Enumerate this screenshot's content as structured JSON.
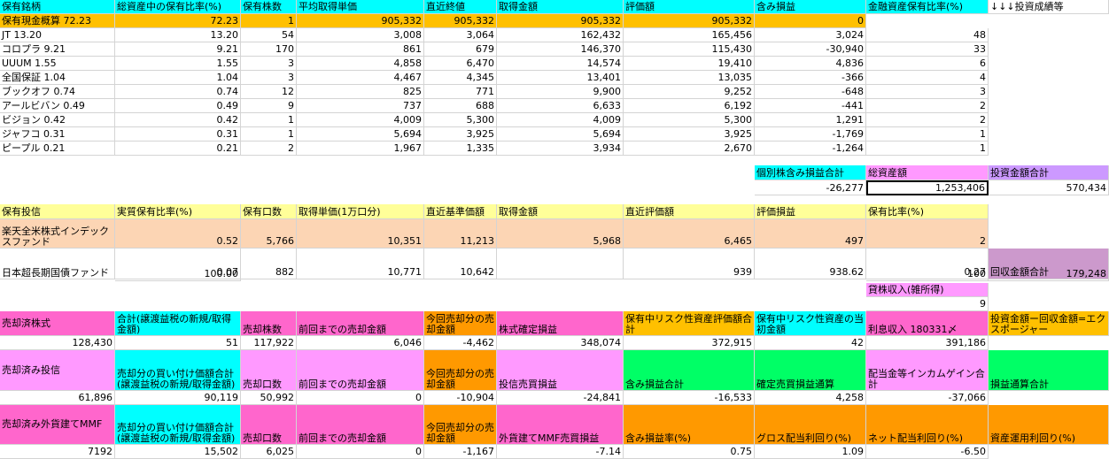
{
  "colors": {
    "cyan": "#00ffff",
    "yellow": "#ffff99",
    "gold": "#ffc000",
    "peach": "#fcd5b4",
    "pink": "#ff66cc",
    "magenta": "#ff99ff",
    "orange": "#ff9900",
    "green": "#00ff66",
    "purple": "#cc99ff",
    "mauve": "#cc99cc"
  },
  "stock_headers": [
    "保有銘柄",
    "総資産中の保有比率(%)",
    "保有株数",
    "平均取得単価",
    "直近終値",
    "取得金額",
    "評価額",
    "含み損益",
    "金融資産保有比率(%)",
    "↓↓↓投資成績等"
  ],
  "cash_row": [
    "保有現金概算  72.23",
    "72.23",
    "1",
    "905,332",
    "905,332",
    "905,332",
    "905,332",
    "0"
  ],
  "stocks": [
    [
      "JT  13.20",
      "13.20",
      "54",
      "3,008",
      "3,064",
      "162,432",
      "165,456",
      "3,024",
      "48"
    ],
    [
      "コロプラ 9.21",
      "9.21",
      "170",
      "861",
      "679",
      "146,370",
      "115,430",
      "-30,940",
      "33"
    ],
    [
      "UUUM  1.55",
      "1.55",
      "3",
      "4,858",
      "6,470",
      "14,574",
      "19,410",
      "4,836",
      "6"
    ],
    [
      "全国保証 1.04",
      "1.04",
      "3",
      "4,467",
      "4,345",
      "13,401",
      "13,035",
      "-366",
      "4"
    ],
    [
      "ブックオフ  0.74",
      "0.74",
      "12",
      "825",
      "771",
      "9,900",
      "9,252",
      "-648",
      "3"
    ],
    [
      "アールビバン 0.49",
      "0.49",
      "9",
      "737",
      "688",
      "6,633",
      "6,192",
      "-441",
      "2"
    ],
    [
      "ビジョン 0.42",
      "0.42",
      "1",
      "4,009",
      "5,300",
      "4,009",
      "5,300",
      "1,291",
      "2"
    ],
    [
      "ジャフコ 0.31",
      "0.31",
      "1",
      "5,694",
      "3,925",
      "5,694",
      "3,925",
      "-1,769",
      "1"
    ],
    [
      "ピープル  0.21",
      "0.21",
      "2",
      "1,967",
      "1,335",
      "3,934",
      "2,670",
      "-1,264",
      "1"
    ]
  ],
  "summary": {
    "labels": [
      "個別株含み損益合計",
      "総資産額",
      "投資金額合計"
    ],
    "values": [
      "-26,277",
      "1,253,406",
      "570,434"
    ]
  },
  "fund_headers": [
    "保有投信",
    "実質保有比率(%)",
    "保有口数",
    "取得単価(1万口分)",
    "直近基準価額",
    "取得金額",
    "直近評価額",
    "評価損益",
    "保有比率(%)"
  ],
  "funds": [
    [
      "楽天全米株式インデックスファンド",
      "0.52",
      "5,766",
      "10,351",
      "11,213",
      "5,968",
      "6,465",
      "497",
      "2"
    ],
    [
      "日本超長期国債ファンド",
      "0.07",
      "882",
      "10,771",
      "10,642",
      "",
      "939",
      "938.62",
      "0.27"
    ]
  ],
  "fund_total": "100.00",
  "recovery": {
    "label": "回収金額合計",
    "ratio": "100",
    "value": "179,248"
  },
  "rental": {
    "label": "貸株収入(雑所得)",
    "value": "9"
  },
  "sold_stock": {
    "labels": [
      "売却済株式",
      "合計(譲渡益税の新規/取得金額)",
      "売却株数",
      "前回までの売却金額",
      "今回売却分の売却金額",
      "株式確定損益",
      "保有中リスク性資産評価額合計",
      "保有中リスク性資産の当初金額",
      "利息収入 180331〆",
      "投資金額ー回収金額=エクスポージャー"
    ],
    "values": [
      "128,430",
      "51",
      "117,922",
      "6,046",
      "-4,462",
      "348,074",
      "372,915",
      "42",
      "391,186"
    ]
  },
  "sold_fund": {
    "labels": [
      "売却済み投信",
      "売却分の買い付け価額合計(譲渡益税の新規/取得金額)",
      "売却口数",
      "前回までの売却金額",
      "今回売却分の売却金額",
      "投信売買損益",
      "含み損益合計",
      "確定売買損益通算",
      "配当金等インカムゲイン合計",
      "損益通算合計"
    ],
    "values": [
      "61,896",
      "90,119",
      "50,992",
      "0",
      "-10,904",
      "-24,841",
      "-16,533",
      "4,258",
      "-37,066"
    ]
  },
  "sold_mmf": {
    "labels": [
      "売却済み外貨建てMMF",
      "売却分の買い付け価額合計(譲渡益税の新規/取得金額)",
      "売却口数",
      "前回までの売却金額",
      "今回売却分の売却金額",
      "外貨建てMMF売買損益",
      "含み損益率(%)",
      "グロス配当利回り(%)",
      "ネット配当利回り(%)",
      "資産運用利回り(%)"
    ],
    "values": [
      "7192",
      "15,502",
      "6,025",
      "0",
      "-1,167",
      "-7.14",
      "0.75",
      "1.09",
      "-6.50"
    ]
  }
}
